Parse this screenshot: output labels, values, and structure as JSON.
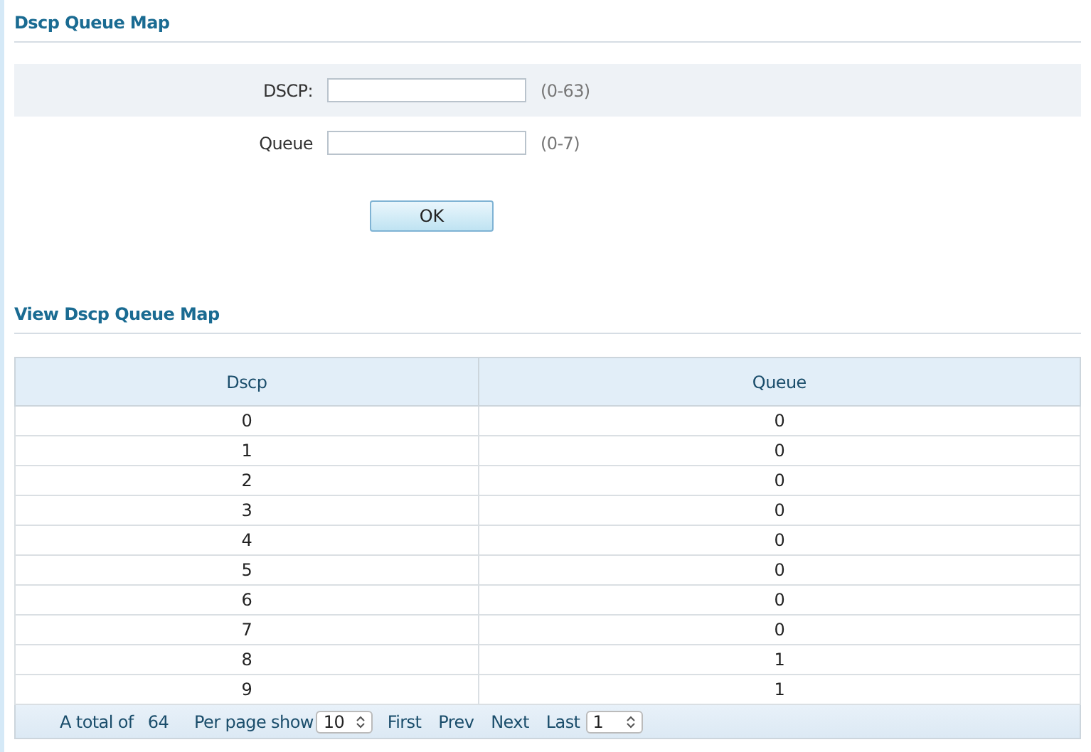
{
  "title": "Dscp Queue Map",
  "form": {
    "fields": [
      {
        "label": "DSCP:",
        "range": "(0-63)",
        "shaded": true
      },
      {
        "label": "Queue",
        "range": "(0-7)",
        "shaded": false
      }
    ],
    "button": "OK"
  },
  "view_title": "View Dscp Queue Map",
  "table": {
    "columns": [
      "Dscp",
      "Queue"
    ],
    "rows": [
      [
        "0",
        "0"
      ],
      [
        "1",
        "0"
      ],
      [
        "2",
        "0"
      ],
      [
        "3",
        "0"
      ],
      [
        "4",
        "0"
      ],
      [
        "5",
        "0"
      ],
      [
        "6",
        "0"
      ],
      [
        "7",
        "0"
      ],
      [
        "8",
        "1"
      ],
      [
        "9",
        "1"
      ]
    ]
  },
  "pager": {
    "total_label": "A total of",
    "total": "64",
    "per_page_label": "Per page show",
    "per_page": "10",
    "first": "First",
    "prev": "Prev",
    "next": "Next",
    "last": "Last",
    "page": "1"
  }
}
